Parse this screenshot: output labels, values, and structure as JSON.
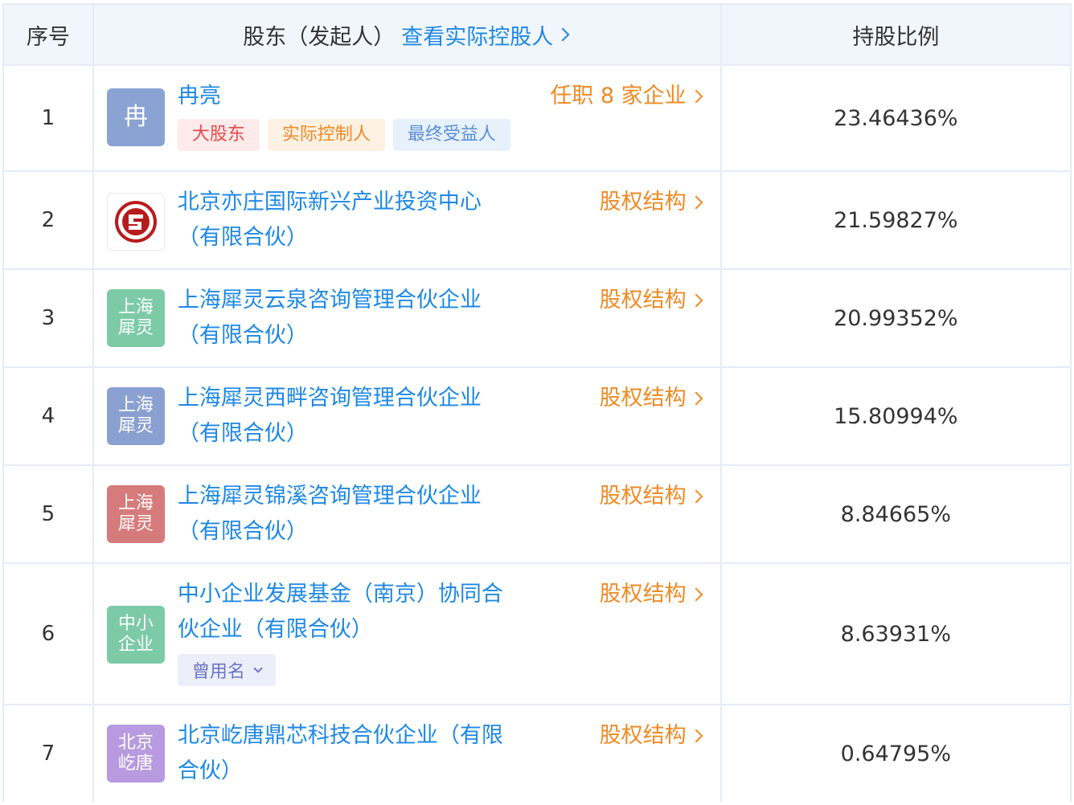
{
  "header": {
    "index_label": "序号",
    "holder_label": "股东（发起人）",
    "holder_link": "查看实际控股人",
    "ratio_label": "持股比例"
  },
  "rows": [
    {
      "index": "1",
      "logo_text": "冉",
      "name": "冉亮",
      "action": "任职 8 家企业",
      "tags": [
        "大股东",
        "实际控制人",
        "最终受益人"
      ],
      "ratio": "23.46436%"
    },
    {
      "index": "2",
      "logo_text": "",
      "name": "北京亦庄国际新兴产业投资中心（有限合伙）",
      "action": "股权结构",
      "ratio": "21.59827%"
    },
    {
      "index": "3",
      "logo_text": "上海犀灵",
      "name": "上海犀灵云泉咨询管理合伙企业（有限合伙）",
      "action": "股权结构",
      "ratio": "20.99352%"
    },
    {
      "index": "4",
      "logo_text": "上海犀灵",
      "name": "上海犀灵西畔咨询管理合伙企业（有限合伙）",
      "action": "股权结构",
      "ratio": "15.80994%"
    },
    {
      "index": "5",
      "logo_text": "上海犀灵",
      "name": "上海犀灵锦溪咨询管理合伙企业（有限合伙）",
      "action": "股权结构",
      "ratio": "8.84665%"
    },
    {
      "index": "6",
      "logo_text": "中小企业",
      "name": "中小企业发展基金（南京）协同合伙企业（有限合伙）",
      "action": "股权结构",
      "former_name_label": "曾用名",
      "ratio": "8.63931%"
    },
    {
      "index": "7",
      "logo_text": "北京屹唐",
      "name": "北京屹唐鼎芯科技合伙企业（有限合伙）",
      "action": "股权结构",
      "ratio": "0.64795%"
    }
  ],
  "colors": {
    "link": "#1e88e5",
    "action": "#f08a24",
    "logo_row1": "#8aa3d3",
    "logo_row3": "#7dcaa7",
    "logo_row4": "#8aa0d0",
    "logo_row5": "#d67b7b",
    "logo_row6": "#7dcaa7",
    "logo_row7": "#b79ae0"
  }
}
